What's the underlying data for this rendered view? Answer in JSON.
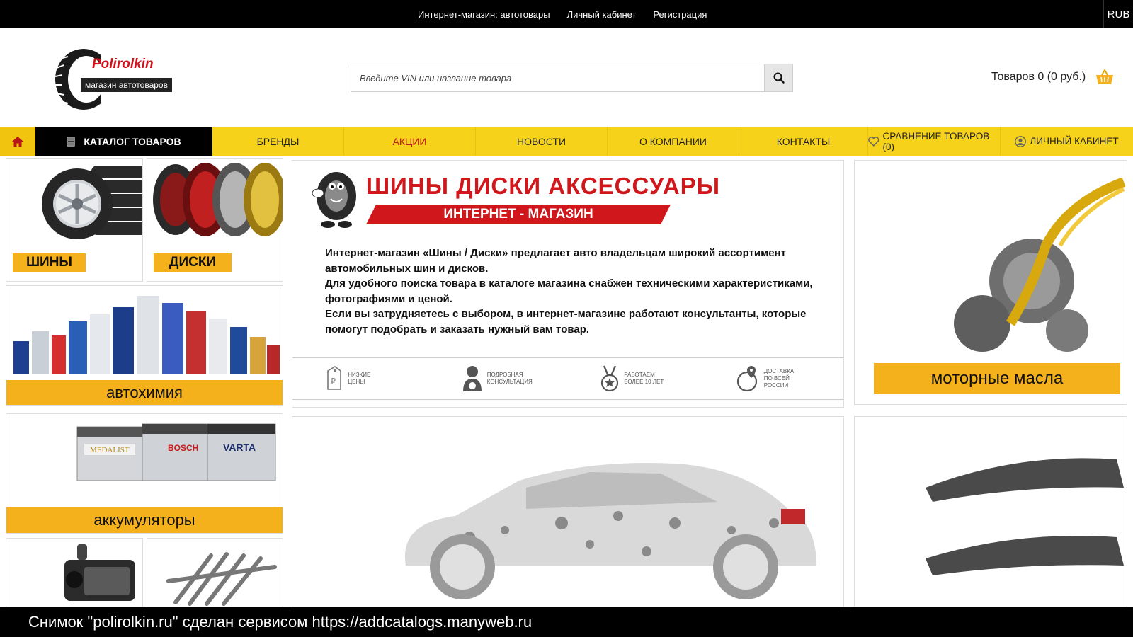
{
  "topbar": {
    "links": [
      "Интернет-магазин: автотовары",
      "Личный кабинет",
      "Регистрация"
    ],
    "currency": "RUB"
  },
  "header": {
    "logo": {
      "name": "Polirolkin",
      "tagline": "магазин автотоваров"
    },
    "search": {
      "placeholder": "Введите VIN или название товара",
      "value": ""
    },
    "cart": {
      "label": "Товаров 0 (0 руб.)"
    }
  },
  "nav": {
    "catalog": "КАТАЛОГ ТОВАРОВ",
    "items": [
      "БРЕНДЫ",
      "АКЦИИ",
      "НОВОСТИ",
      "О КОМПАНИИ",
      "КОНТАКТЫ"
    ],
    "active_item": "АКЦИИ",
    "compare": "СРАВНЕНИЕ ТОВАРОВ (0)",
    "account": "ЛИЧНЫЙ КАБИНЕТ"
  },
  "categories": {
    "tires": "ШИНЫ",
    "wheels": "ДИСКИ",
    "chemistry": "автохимия",
    "batteries": "аккумуляторы",
    "oils": "моторные масла"
  },
  "banner": {
    "title": "ШИНЫ  ДИСКИ  АКСЕССУАРЫ",
    "subtitle": "ИНТЕРНЕТ - МАГАЗИН",
    "paragraph_1": "Интернет-магазин  «Шины / Диски» предлагает авто владельцам широкий ассортимент автомобильных шин и дисков.",
    "paragraph_2": "Для удобного поиска товара в каталоге магазина снабжен техническими характеристиками, фотографиями и ценой.",
    "paragraph_3": "Если вы затрудняетесь с выбором, в интернет-магазине работают консультанты, которые помогут подобрать и заказать нужный вам товар.",
    "features": [
      "НИЗКИЕ\nЦЕНЫ",
      "ПОДРОБНАЯ\nКОНСУЛЬТАЦИЯ",
      "РАБОТАЕМ\nБОЛЕЕ 10 ЛЕТ",
      "ДОСТАВКА\nПО ВСЕЙ РОССИИ"
    ],
    "battery_brands": [
      "MEDALIST",
      "BOSCH",
      "VARTA"
    ]
  },
  "watermark": "Снимок \"polirolkin.ru\" сделан сервисом https://addcatalogs.manyweb.ru",
  "colors": {
    "accent_yellow": "#f7d21a",
    "badge_orange": "#f4b11b",
    "brand_red": "#d0181c",
    "black": "#000000"
  }
}
